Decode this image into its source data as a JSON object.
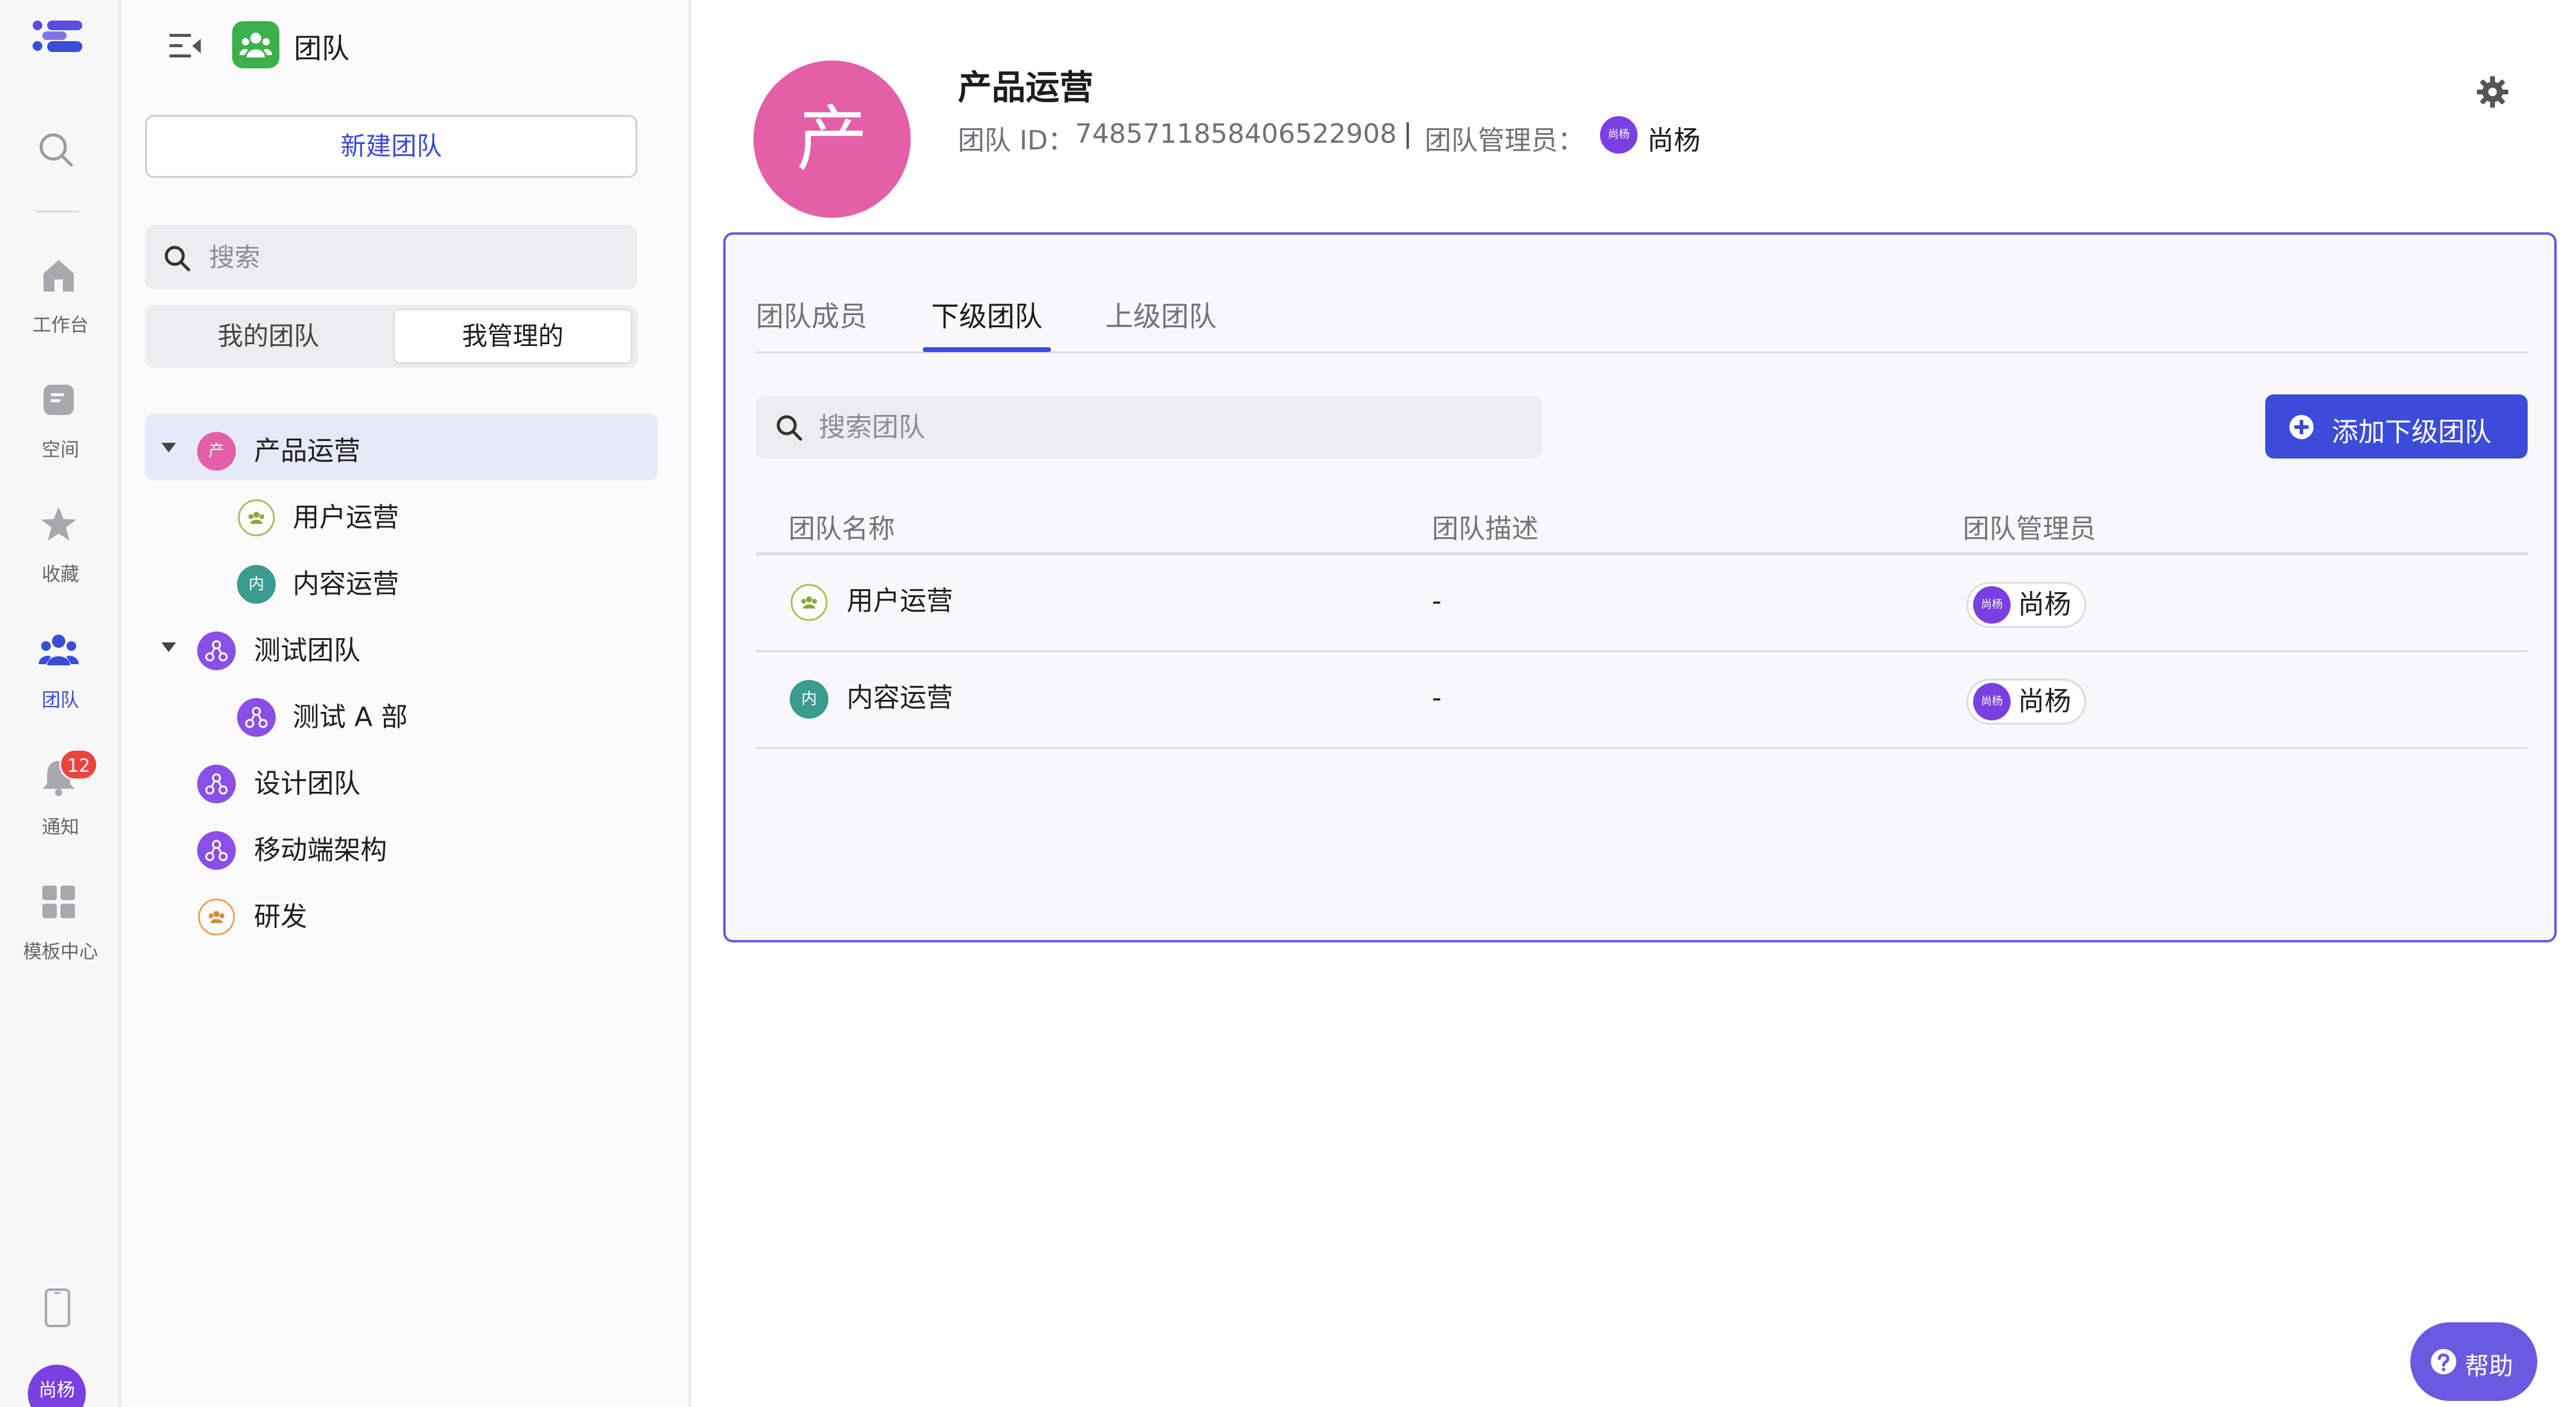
{
  "rail": {
    "items": [
      {
        "label": "工作台"
      },
      {
        "label": "空间"
      },
      {
        "label": "收藏"
      },
      {
        "label": "团队"
      },
      {
        "label": "通知"
      },
      {
        "label": "模板中心"
      }
    ],
    "notification_count": "12",
    "user_avatar": "尚杨"
  },
  "panel": {
    "title": "团队",
    "new_team_label": "新建团队",
    "search_placeholder": "搜索",
    "segments": {
      "mine": "我的团队",
      "managed": "我管理的"
    },
    "tree": [
      {
        "label": "产品运营",
        "avatar": "产",
        "selected": true
      },
      {
        "label": "用户运营"
      },
      {
        "label": "内容运营",
        "avatar": "内"
      },
      {
        "label": "测试团队"
      },
      {
        "label": "测试 A 部"
      },
      {
        "label": "设计团队"
      },
      {
        "label": "移动端架构"
      },
      {
        "label": "研发"
      }
    ]
  },
  "header": {
    "avatar": "产",
    "name": "产品运营",
    "id_label": "团队 ID：",
    "id_value": "7485711858406522908",
    "admin_label": "团队管理员：",
    "admin_avatar": "尚杨",
    "admin_name": "尚杨"
  },
  "tabs": [
    {
      "label": "团队成员"
    },
    {
      "label": "下级团队",
      "active": true
    },
    {
      "label": "上级团队"
    }
  ],
  "subteams": {
    "search_placeholder": "搜索团队",
    "add_label": "添加下级团队",
    "columns": {
      "name": "团队名称",
      "desc": "团队描述",
      "admin": "团队管理员"
    },
    "rows": [
      {
        "name": "用户运营",
        "desc": "-",
        "admin_avatar": "尚杨",
        "admin": "尚杨"
      },
      {
        "name": "内容运营",
        "avatar": "内",
        "desc": "-",
        "admin_avatar": "尚杨",
        "admin": "尚杨"
      }
    ]
  },
  "help_label": "帮助",
  "colors": {
    "accent": "#3b4cd8",
    "card_border": "#6a5ae0",
    "team_pink": "#e35fa8",
    "team_green": "#3cb04a",
    "admin_purple": "#7a3fe0",
    "teal": "#3a9b8e",
    "badge_red": "#e9453d"
  },
  "icons": [
    "logo-icon",
    "search-icon",
    "home-icon",
    "space-icon",
    "star-icon",
    "team-icon",
    "bell-icon",
    "template-icon",
    "phone-icon",
    "collapse-icon",
    "gear-icon",
    "plus-circle-icon",
    "help-icon",
    "caret-down-icon"
  ]
}
